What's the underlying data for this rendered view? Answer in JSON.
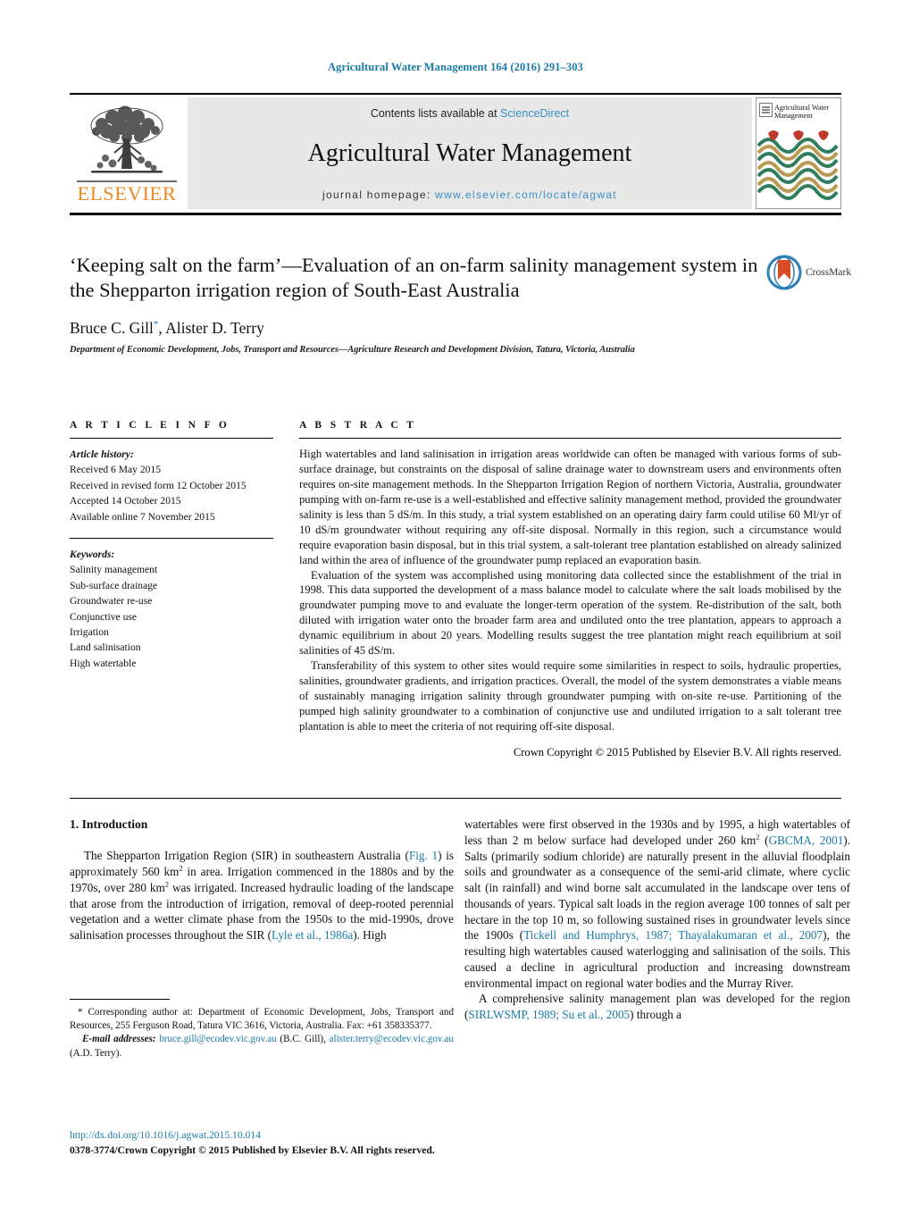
{
  "running_head": "Agricultural Water Management 164 (2016) 291–303",
  "masthead": {
    "contents_prefix": "Contents lists available at ",
    "sciencedirect": "ScienceDirect",
    "journal_name": "Agricultural Water Management",
    "homepage_prefix": "journal homepage: ",
    "homepage_url": "www.elsevier.com/locate/agwat",
    "publisher_wordmark": "ELSEVIER",
    "cover_title": "Agricultural Water Management",
    "accent_blue": "#3a8fc4",
    "link_blue": "#1a7aa8",
    "elsevier_orange": "#f08a24"
  },
  "article": {
    "title": "‘Keeping salt on the farm’—Evaluation of an on-farm salinity management system in the Shepparton irrigation region of South-East Australia",
    "authors": "Bruce C. Gill",
    "authors_suffix": ", Alister D. Terry",
    "corresponding_marker": "*",
    "affiliation": "Department of Economic Development, Jobs, Transport and Resources—Agriculture Research and Development Division, Tatura, Victoria, Australia",
    "crossmark_label": "CrossMark"
  },
  "article_info": {
    "heading": "A R T I C L E   I N F O",
    "history_label": "Article history:",
    "history": [
      "Received 6 May 2015",
      "Received in revised form 12 October 2015",
      "Accepted 14 October 2015",
      "Available online 7 November 2015"
    ],
    "keywords_label": "Keywords:",
    "keywords": [
      "Salinity management",
      "Sub-surface drainage",
      "Groundwater re-use",
      "Conjunctive use",
      "Irrigation",
      "Land salinisation",
      "High watertable"
    ]
  },
  "abstract": {
    "heading": "A B S T R A C T",
    "paragraphs": [
      "High watertables and land salinisation in irrigation areas worldwide can often be managed with various forms of sub-surface drainage, but constraints on the disposal of saline drainage water to downstream users and environments often requires on-site management methods. In the Shepparton Irrigation Region of northern Victoria, Australia, groundwater pumping with on-farm re-use is a well-established and effective salinity management method, provided the groundwater salinity is less than 5 dS/m. In this study, a trial system established on an operating dairy farm could utilise 60 Ml/yr of 10 dS/m groundwater without requiring any off-site disposal. Normally in this region, such a circumstance would require evaporation basin disposal, but in this trial system, a salt-tolerant tree plantation established on already salinized land within the area of influence of the groundwater pump replaced an evaporation basin.",
      "Evaluation of the system was accomplished using monitoring data collected since the establishment of the trial in 1998. This data supported the development of a mass balance model to calculate where the salt loads mobilised by the groundwater pumping move to and evaluate the longer-term operation of the system. Re-distribution of the salt, both diluted with irrigation water onto the broader farm area and undiluted onto the tree plantation, appears to approach a dynamic equilibrium in about 20 years. Modelling results suggest the tree plantation might reach equilibrium at soil salinities of 45 dS/m.",
      "Transferability of this system to other sites would require some similarities in respect to soils, hydraulic properties, salinities, groundwater gradients, and irrigation practices. Overall, the model of the system demonstrates a viable means of sustainably managing irrigation salinity through groundwater pumping with on-site re-use. Partitioning of the pumped high salinity groundwater to a combination of conjunctive use and undiluted irrigation to a salt tolerant tree plantation is able to meet the criteria of not requiring off-site disposal."
    ],
    "copyright": "Crown Copyright © 2015 Published by Elsevier B.V. All rights reserved."
  },
  "body": {
    "section_heading": "1. Introduction",
    "left": {
      "p1_a": "The Shepparton Irrigation Region (SIR) in southeastern Australia (",
      "p1_figlink": "Fig. 1",
      "p1_b": ") is approximately 560 km",
      "p1_sup1": "2",
      "p1_c": " in area. Irrigation commenced in the 1880s and by the 1970s, over 280 km",
      "p1_sup2": "2",
      "p1_d": " was irrigated. Increased hydraulic loading of the landscape that arose from the introduction of irrigation, removal of deep-rooted perennial vegetation and a wetter climate phase from the 1950s to the mid-1990s, drove salinisation processes throughout the SIR (",
      "p1_cite1": "Lyle et al., 1986a",
      "p1_e": "). High"
    },
    "right": {
      "p1_a": "watertables were first observed in the 1930s and by 1995, a high watertables of less than 2 m below surface had developed under 260 km",
      "p1_sup1": "2",
      "p1_b": " (",
      "p1_cite1": "GBCMA, 2001",
      "p1_c": "). Salts (primarily sodium chloride) are naturally present in the alluvial floodplain soils and groundwater as a consequence of the semi-arid climate, where cyclic salt (in rainfall) and wind borne salt accumulated in the landscape over tens of thousands of years. Typical salt loads in the region average 100 tonnes of salt per hectare in the top 10 m, so following sustained rises in groundwater levels since the 1900s (",
      "p1_cite2": "Tickell and Humphrys, 1987; Thayalakumaran et al., 2007",
      "p1_d": "), the resulting high watertables caused waterlogging and salinisation of the soils. This caused a decline in agricultural production and increasing downstream environmental impact on regional water bodies and the Murray River.",
      "p2_a": "A comprehensive salinity management plan was developed for the region (",
      "p2_cite1": "SIRLWSMP, 1989; Su et al., 2005",
      "p2_b": ") through a"
    }
  },
  "footnotes": {
    "corresponding": "* Corresponding author at: Department of Economic Development, Jobs, Transport and Resources, 255 Ferguson Road, Tatura VIC 3616, Victoria, Australia. Fax: +61 358335377.",
    "email_label": "E-mail addresses:",
    "email1": "bruce.gill@ecodev.vic.gov.au",
    "email1_owner": " (B.C. Gill),",
    "email2": "alister.terry@ecodev.vic.gov.au",
    "email2_owner": " (A.D. Terry).",
    "doi_url": "http://dx.doi.org/10.1016/j.agwat.2015.10.014",
    "issn_line": "0378-3774/Crown Copyright © 2015 Published by Elsevier B.V. All rights reserved."
  }
}
